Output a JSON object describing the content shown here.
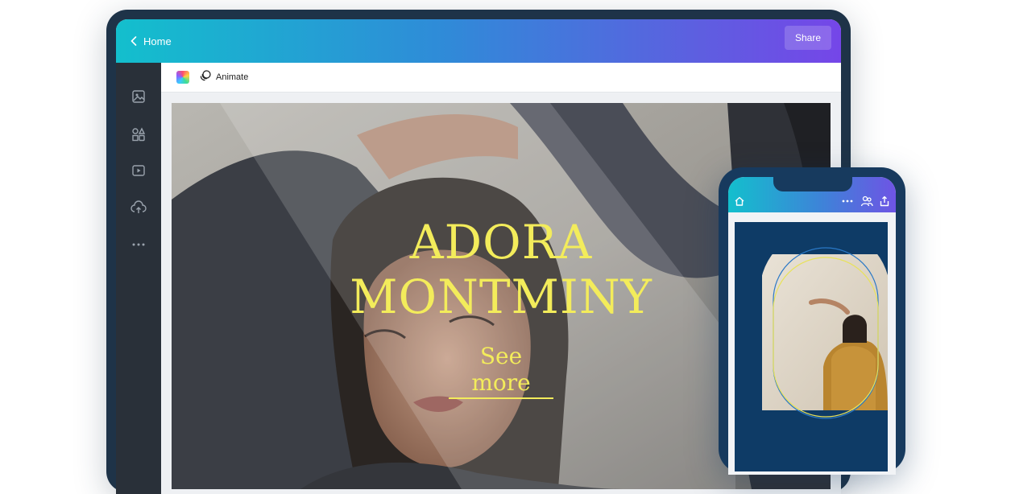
{
  "editor": {
    "home_label": "Home",
    "share_label": "Share",
    "animate_label": "Animate"
  },
  "sidebar": {
    "items": [
      {
        "icon": "photos-icon"
      },
      {
        "icon": "elements-icon"
      },
      {
        "icon": "videos-icon"
      },
      {
        "icon": "uploads-icon"
      },
      {
        "icon": "more-icon"
      }
    ]
  },
  "design": {
    "title_line1": "ADORA",
    "title_line2": "MONTMINY",
    "cta": "See more"
  },
  "phone": {
    "icons": [
      "home-icon",
      "more-icon",
      "collaborate-icon",
      "share-icon"
    ]
  },
  "colors": {
    "gradient_start": "#13bfcd",
    "gradient_end": "#7546e8",
    "headline": "#f3ec5b",
    "phone_design_bg": "#0e3b66",
    "sidebar": "#293039"
  }
}
